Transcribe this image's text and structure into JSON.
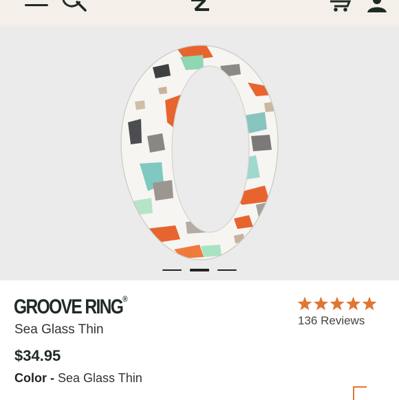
{
  "header": {
    "icons": [
      "menu-icon",
      "search-icon",
      "logo-mark",
      "cart-icon",
      "account-icon"
    ]
  },
  "gallery": {
    "image": "sea-glass-thin-ring",
    "slide_count": 3,
    "active_slide": 2
  },
  "product": {
    "brand": "GROOVE RING",
    "brand_mark": "®",
    "name": "Sea Glass Thin",
    "price": "$34.95",
    "color_label": "Color -",
    "color_value": "Sea Glass Thin",
    "rating": 5,
    "rating_max": 5,
    "reviews_text": "136 Reviews"
  },
  "colors": {
    "header_bg": "#f4efe9",
    "gallery_bg": "#ebebeb",
    "star": "#e07633",
    "text_dark": "#1f2a24"
  }
}
